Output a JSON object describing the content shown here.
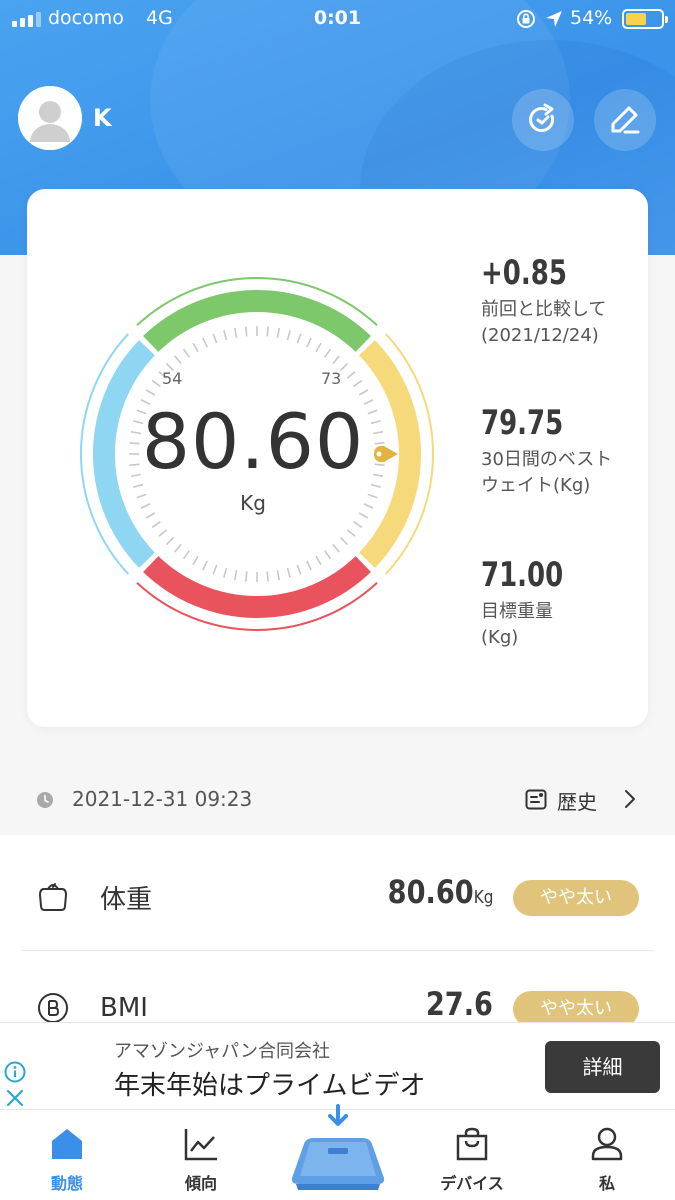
{
  "status_bar": {
    "carrier": "docomo",
    "network": "4G",
    "time": "0:01",
    "battery": "54%"
  },
  "header": {
    "user_name": "K",
    "icons": [
      "avatar",
      "sync-icon",
      "edit-icon"
    ]
  },
  "gauge": {
    "weight": "80.60",
    "unit": "Kg",
    "tick_low": "54",
    "tick_high": "73",
    "colors": {
      "low": "#8fd6f2",
      "normal": "#7dc86a",
      "high": "#f6d97a",
      "obese": "#e9535e",
      "pointer": "#e3b342"
    }
  },
  "stats": [
    {
      "value": "+0.85",
      "label_line1": "前回と比較して",
      "label_line2": "(2021/12/24)"
    },
    {
      "value": "79.75",
      "label_line1": "30日間のベスト",
      "label_line2": "ウェイト(Kg)"
    },
    {
      "value": "71.00",
      "label_line1": "目標重量",
      "label_line2": "(Kg)"
    }
  ],
  "date_row": {
    "datetime": "2021-12-31 09:23",
    "history_label": "歴史"
  },
  "metrics": [
    {
      "name": "体重",
      "value": "80.60",
      "unit": "Kg",
      "badge": "やや太い",
      "icon": "weight-icon"
    },
    {
      "name": "BMI",
      "value": "27.6",
      "unit": "",
      "badge": "やや太い",
      "icon": "bmi-icon"
    }
  ],
  "ad": {
    "company": "アマゾンジャパン合同会社",
    "title": "年末年始はプライムビデオ",
    "button": "詳細"
  },
  "tabs": [
    {
      "label": "動態",
      "icon": "home-icon",
      "active": true
    },
    {
      "label": "傾向",
      "icon": "trend-icon",
      "active": false
    },
    {
      "label": "",
      "icon": "scale-icon",
      "active": false
    },
    {
      "label": "デバイス",
      "icon": "bag-icon",
      "active": false
    },
    {
      "label": "私",
      "icon": "person-icon",
      "active": false
    }
  ]
}
